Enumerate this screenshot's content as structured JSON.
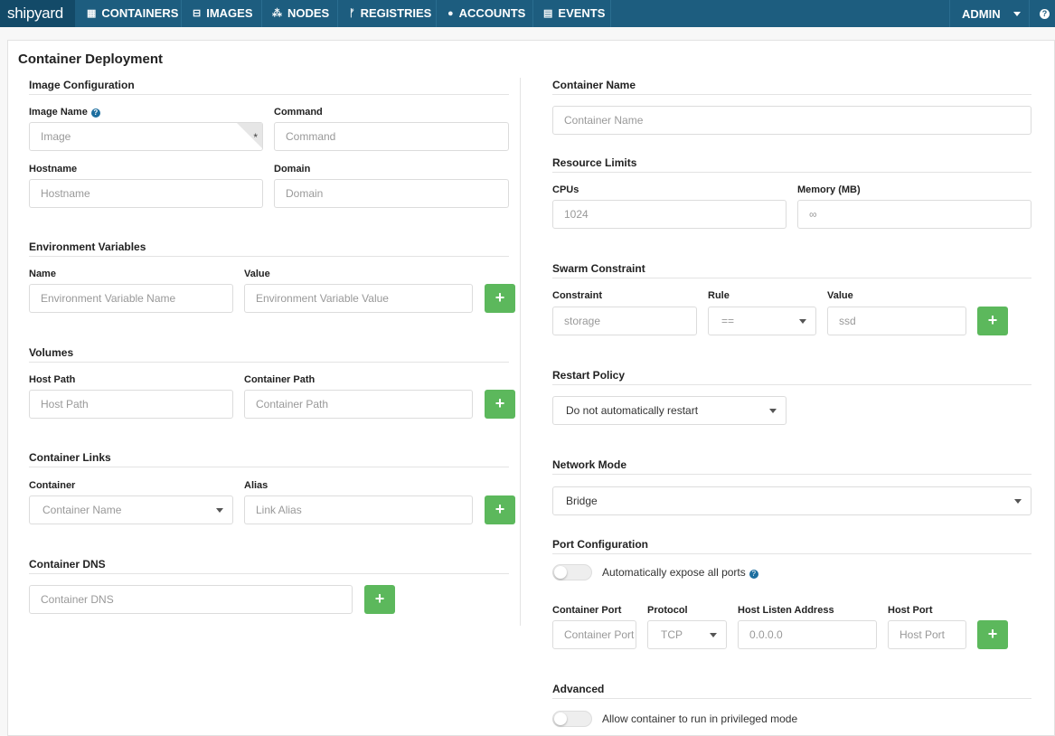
{
  "nav": {
    "logo": "shipyard",
    "items": [
      {
        "label": "CONTAINERS",
        "icon": "grid-icon",
        "glyph": "▦"
      },
      {
        "label": "IMAGES",
        "icon": "drive-icon",
        "glyph": "⊟"
      },
      {
        "label": "NODES",
        "icon": "sitemap-icon",
        "glyph": "⁂"
      },
      {
        "label": "REGISTRIES",
        "icon": "branch-icon",
        "glyph": "ᚠ"
      },
      {
        "label": "ACCOUNTS",
        "icon": "user-icon",
        "glyph": "●"
      },
      {
        "label": "EVENTS",
        "icon": "list-icon",
        "glyph": "▤"
      }
    ],
    "user": "ADMIN",
    "help_glyph": "?"
  },
  "page": {
    "title": "Container Deployment"
  },
  "image_config": {
    "title": "Image Configuration",
    "image_name_label": "Image Name",
    "image_placeholder": "Image",
    "required_mark": "*",
    "command_label": "Command",
    "command_placeholder": "Command",
    "hostname_label": "Hostname",
    "hostname_placeholder": "Hostname",
    "domain_label": "Domain",
    "domain_placeholder": "Domain"
  },
  "env": {
    "title": "Environment Variables",
    "name_label": "Name",
    "name_placeholder": "Environment Variable Name",
    "value_label": "Value",
    "value_placeholder": "Environment Variable Value"
  },
  "volumes": {
    "title": "Volumes",
    "host_label": "Host Path",
    "host_placeholder": "Host Path",
    "container_label": "Container Path",
    "container_placeholder": "Container Path"
  },
  "links": {
    "title": "Container Links",
    "container_label": "Container",
    "container_placeholder": "Container Name",
    "alias_label": "Alias",
    "alias_placeholder": "Link Alias"
  },
  "dns": {
    "title": "Container DNS",
    "placeholder": "Container DNS"
  },
  "container_name": {
    "title": "Container Name",
    "placeholder": "Container Name"
  },
  "resources": {
    "title": "Resource Limits",
    "cpus_label": "CPUs",
    "cpus_placeholder": "1024",
    "memory_label": "Memory (MB)",
    "memory_placeholder": "∞"
  },
  "swarm": {
    "title": "Swarm Constraint",
    "constraint_label": "Constraint",
    "constraint_placeholder": "storage",
    "rule_label": "Rule",
    "rule_value": "==",
    "value_label": "Value",
    "value_placeholder": "ssd"
  },
  "restart": {
    "title": "Restart Policy",
    "value": "Do not automatically restart"
  },
  "network": {
    "title": "Network Mode",
    "value": "Bridge"
  },
  "ports": {
    "title": "Port Configuration",
    "expose_label": "Automatically expose all ports",
    "container_port_label": "Container Port",
    "container_port_placeholder": "Container Port",
    "protocol_label": "Protocol",
    "protocol_value": "TCP",
    "host_address_label": "Host Listen Address",
    "host_address_placeholder": "0.0.0.0",
    "host_port_label": "Host Port",
    "host_port_placeholder": "Host Port"
  },
  "advanced": {
    "title": "Advanced",
    "privileged_label": "Allow container to run in privileged mode"
  },
  "add_glyph": "+"
}
